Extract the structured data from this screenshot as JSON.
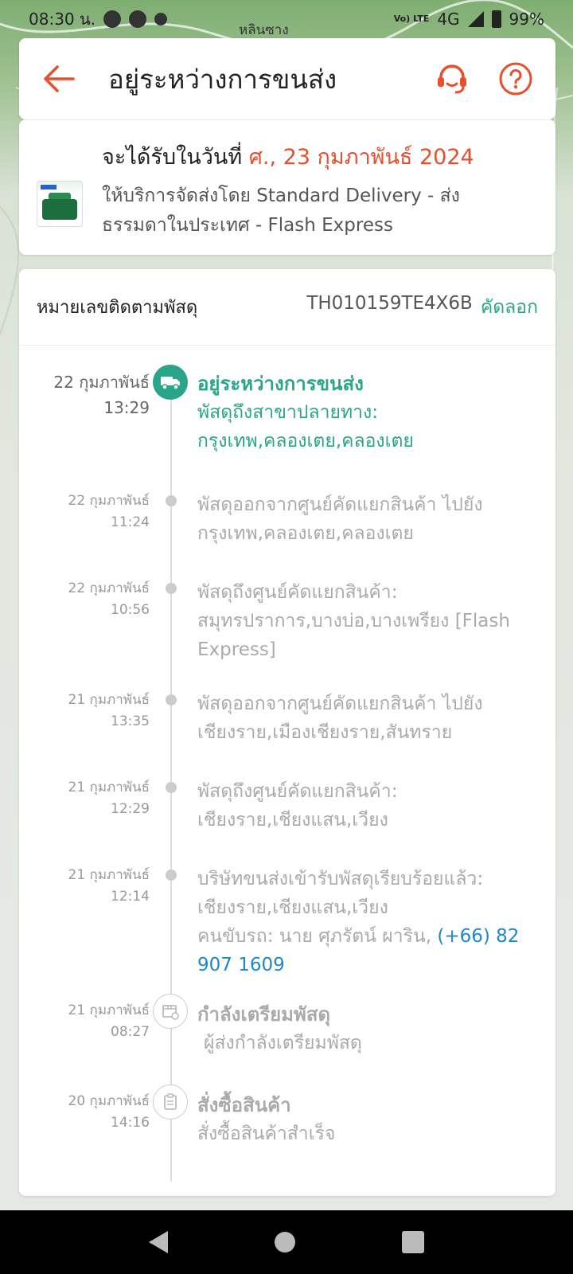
{
  "status_bar": {
    "time": "08:30 น.",
    "network": "4G",
    "lte_label": "Vo) LTE",
    "battery": "99%",
    "map_place": "หลินซาง"
  },
  "header": {
    "title": "อยู่ระหว่างการขนส่ง"
  },
  "delivery": {
    "eta_prefix": "จะได้รับในวันที่",
    "eta_date": "ศ., 23 กุมภาพันธ์ 2024",
    "service_text": "ให้บริการจัดส่งโดย Standard Delivery - ส่งธรรมดาในประเทศ - Flash Express"
  },
  "tracking": {
    "label": "หมายเลขติดตามพัสดุ",
    "number": "TH010159TE4X6B",
    "copy_label": "คัดลอก"
  },
  "timeline": [
    {
      "date": "22 กุมภาพันธ์",
      "time": "13:29",
      "title": "อยู่ระหว่างการขนส่ง",
      "text": "พัสดุถึงสาขาปลายทาง: กรุงเทพ,คลองเตย,คลองเตย"
    },
    {
      "date": "22 กุมภาพันธ์",
      "time": "11:24",
      "text": "พัสดุออกจากศูนย์คัดแยกสินค้า ไปยัง กรุงเทพ,คลองเตย,คลองเตย"
    },
    {
      "date": "22 กุมภาพันธ์",
      "time": "10:56",
      "text": "พัสดุถึงศูนย์คัดแยกสินค้า: สมุทรปราการ,บางบ่อ,บางเพรียง [Flash Express]"
    },
    {
      "date": "21 กุมภาพันธ์",
      "time": "13:35",
      "text": "พัสดุออกจากศูนย์คัดแยกสินค้า ไปยัง เชียงราย,เมืองเชียงราย,สันทราย"
    },
    {
      "date": "21 กุมภาพันธ์",
      "time": "12:29",
      "text": "พัสดุถึงศูนย์คัดแยกสินค้า: เชียงราย,เชียงแสน,เวียง"
    },
    {
      "date": "21 กุมภาพันธ์",
      "time": "12:14",
      "text": "บริษัทขนส่งเข้ารับพัสดุเรียบร้อยแล้ว: เชียงราย,เชียงแสน,เวียง",
      "driver": "คนขับรถ: นาย ศุภรัตน์ ผาริน,",
      "phone": "(+66) 82 907 1609"
    },
    {
      "date": "21 กุมภาพันธ์",
      "time": "08:27",
      "title": "กำลังเตรียมพัสดุ",
      "text": "ผู้ส่งกำลังเตรียมพัสดุ"
    },
    {
      "date": "20 กุมภาพันธ์",
      "time": "14:16",
      "title": "สั่งซื้อสินค้า",
      "text": "สั่งซื้อสินค้าสำเร็จ"
    }
  ],
  "colors": {
    "accent": "#e5502e",
    "teal": "#2aa58a",
    "link_blue": "#1e88c7"
  },
  "icons": [
    "back-arrow-icon",
    "headset-icon",
    "help-icon",
    "truck-icon",
    "package-icon",
    "receipt-icon"
  ]
}
